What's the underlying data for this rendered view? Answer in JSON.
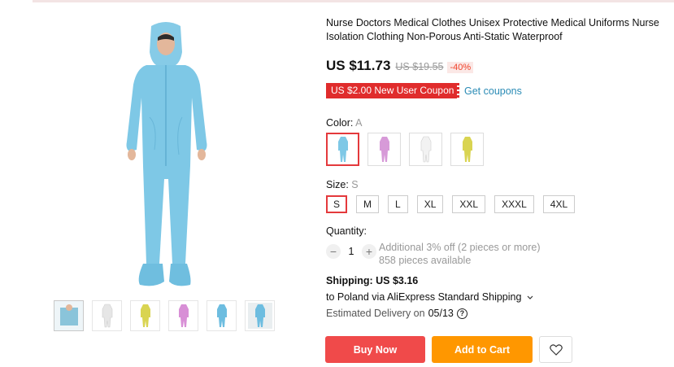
{
  "product": {
    "title": "Nurse Doctors Medical Clothes Unisex Protective Medical Uniforms Nurse Isolation Clothing Non-Porous Anti-Static Waterproof",
    "price": "US $11.73",
    "old_price": "US $19.55",
    "discount": "-40%"
  },
  "coupon": {
    "label": "US $2.00 New User Coupon",
    "link": "Get coupons"
  },
  "color": {
    "label": "Color:",
    "selected": "A",
    "options": [
      {
        "name": "blue",
        "hex": "#7ec8e6"
      },
      {
        "name": "purple",
        "hex": "#d79ad8"
      },
      {
        "name": "white",
        "hex": "#f2f2f2"
      },
      {
        "name": "yellow",
        "hex": "#d9d451"
      }
    ]
  },
  "size": {
    "label": "Size:",
    "selected": "S",
    "options": [
      "S",
      "M",
      "L",
      "XL",
      "XXL",
      "XXXL",
      "4XL"
    ]
  },
  "quantity": {
    "label": "Quantity:",
    "value": "1",
    "minus": "−",
    "plus": "+",
    "note": "Additional 3% off (2 pieces or more)",
    "available": "858 pieces available"
  },
  "shipping": {
    "label": "Shipping:",
    "cost": "US $3.16",
    "method": "to Poland via AliExpress Standard Shipping",
    "delivery_label": "Estimated Delivery on",
    "delivery_date": "05/13",
    "help_icon": "?"
  },
  "actions": {
    "buy_now": "Buy Now",
    "add_to_cart": "Add to Cart"
  },
  "thumbnails": [
    {
      "name": "person-blue"
    },
    {
      "name": "white"
    },
    {
      "name": "yellow"
    },
    {
      "name": "pink"
    },
    {
      "name": "blue"
    },
    {
      "name": "blue-back"
    }
  ],
  "colors": {
    "accent_red": "#e4393c",
    "buy_now": "#f04a4a",
    "add_to_cart": "#ff9700",
    "link_blue": "#2a8bb5",
    "suit_blue": "#7ec8e6"
  }
}
